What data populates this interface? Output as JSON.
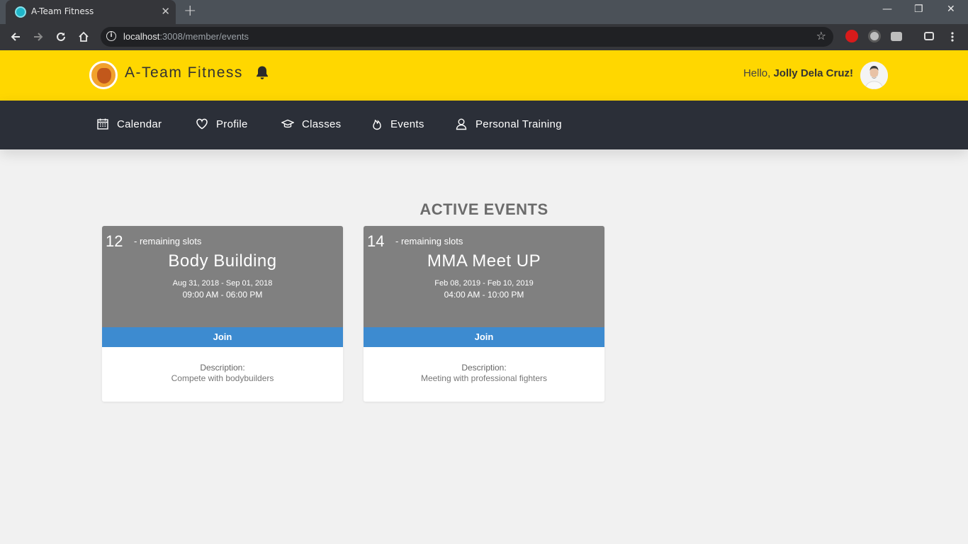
{
  "browser": {
    "tab_title": "A-Team Fitness",
    "tab_close": "✕",
    "new_tab": "+",
    "url_host": "localhost",
    "url_path": ":3008/member/events",
    "star": "☆",
    "minimize": "—",
    "restore": "❐",
    "close": "✕"
  },
  "header": {
    "brand": "A-Team Fitness",
    "greeting_prefix": "Hello, ",
    "user_name": "Jolly Dela Cruz!",
    "accent_color": "#ffd700"
  },
  "nav": {
    "items": [
      {
        "label": "Calendar",
        "icon": "calendar-icon"
      },
      {
        "label": "Profile",
        "icon": "heart-icon"
      },
      {
        "label": "Classes",
        "icon": "graduation-cap-icon"
      },
      {
        "label": "Events",
        "icon": "flame-icon"
      },
      {
        "label": "Personal Training",
        "icon": "user-icon"
      }
    ]
  },
  "main": {
    "title": "ACTIVE EVENTS",
    "events": [
      {
        "slots": "12",
        "slots_label": "- remaining slots",
        "title": "Body Building",
        "dates": "Aug 31, 2018 - Sep 01, 2018",
        "times": "09:00 AM - 06:00 PM",
        "join_label": "Join",
        "description_label": "Description:",
        "description": "Compete with bodybuilders"
      },
      {
        "slots": "14",
        "slots_label": "- remaining slots",
        "title": "MMA Meet UP",
        "dates": "Feb 08, 2019 - Feb 10, 2019",
        "times": "04:00 AM - 10:00 PM",
        "join_label": "Join",
        "description_label": "Description:",
        "description": "Meeting with professional fighters"
      }
    ]
  }
}
